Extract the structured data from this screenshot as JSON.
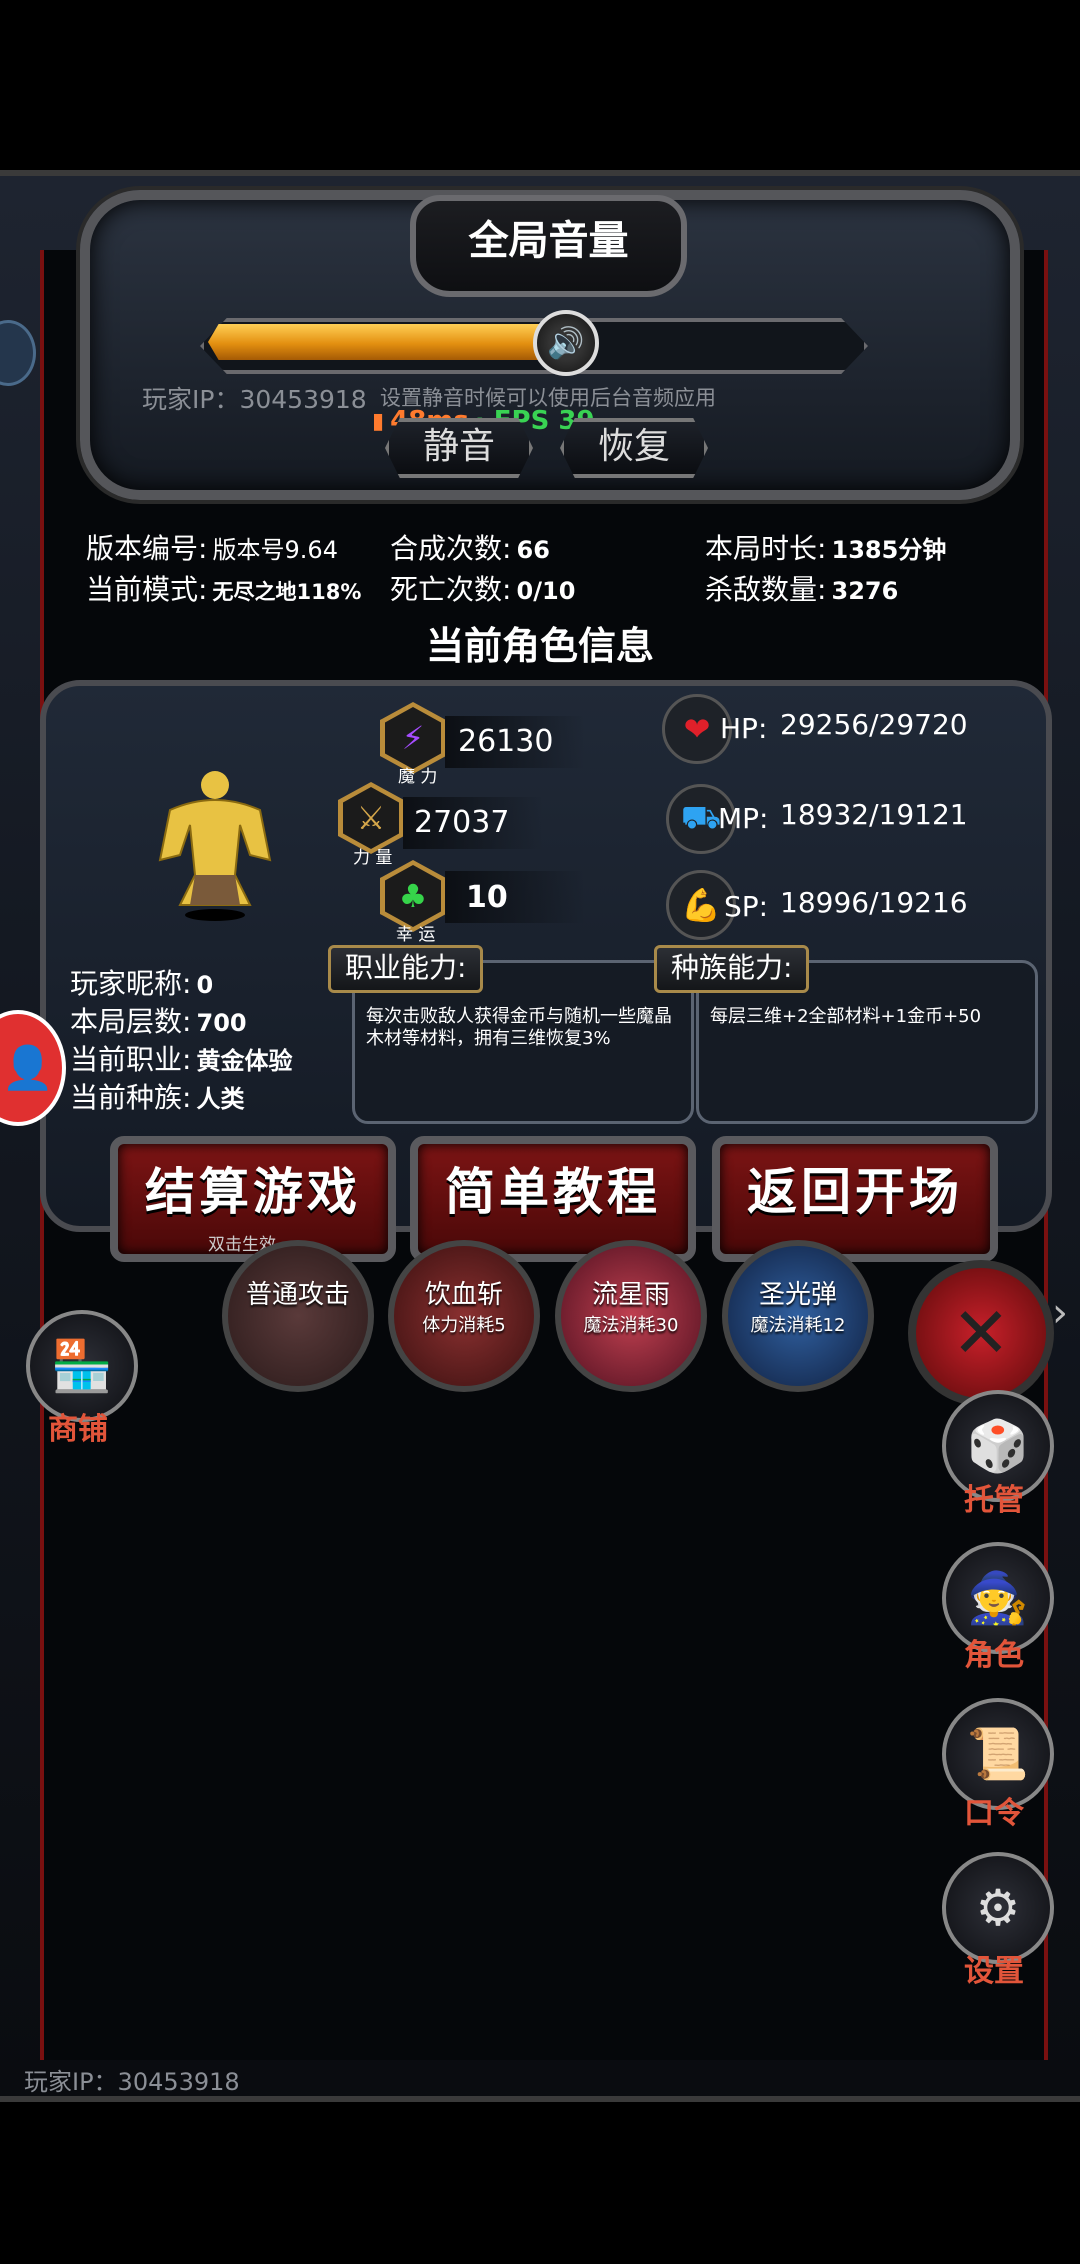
{
  "volume_panel": {
    "title": "全局音量",
    "level_percent": 55,
    "player_ip": "玩家IP：30453918",
    "mute_hint": "设置静音时候可以使用后台音频应用",
    "ping": "48ms",
    "fps": "· FPS 39",
    "mute_label": "静音",
    "restore_label": "恢复"
  },
  "info": {
    "version_label": "版本编号:",
    "version_value": "版本号9.64",
    "mode_label": "当前模式:",
    "mode_value": "无尽之地118%",
    "merge_label": "合成次数:",
    "merge_value": "66",
    "death_label": "死亡次数:",
    "death_value": "0/10",
    "duration_label": "本局时长:",
    "duration_value": "1385分钟",
    "kills_label": "杀敌数量:",
    "kills_value": "3276"
  },
  "character": {
    "section_title": "当前角色信息",
    "magic_value": "26130",
    "magic_label": "魔 力",
    "strength_value": "27037",
    "strength_label": "力 量",
    "luck_value": "10",
    "luck_label": "幸 运",
    "hp_label": "HP:",
    "hp_value": "29256/29720",
    "mp_label": "MP:",
    "mp_value": "18932/19121",
    "sp_label": "SP:",
    "sp_value": "18996/19216",
    "nickname_label": "玩家昵称:",
    "nickname_value": "0",
    "floor_label": "本局层数:",
    "floor_value": "700",
    "job_label": "当前职业:",
    "job_value": "黄金体验",
    "race_label": "当前种族:",
    "race_value": "人类",
    "job_ability_title": "职业能力:",
    "job_ability_text": "每次击败敌人获得金币与随机一些魔晶木材等材料，拥有三维恢复3%",
    "race_ability_title": "种族能力:",
    "race_ability_text": "每层三维+2全部材料+1金币+50"
  },
  "actions": {
    "settle_label": "结算游戏",
    "settle_sub": "双击生效",
    "tutorial_label": "简单教程",
    "return_label": "返回开场"
  },
  "skills": [
    {
      "name": "普通攻击",
      "cost": ""
    },
    {
      "name": "饮血斩",
      "cost": "体力消耗5"
    },
    {
      "name": "流星雨",
      "cost": "魔法消耗30"
    },
    {
      "name": "圣光弹",
      "cost": "魔法消耗12"
    }
  ],
  "side": {
    "shop_label": "商铺",
    "auto_label": "托管",
    "role_label": "角色",
    "code_label": "口令",
    "settings_label": "设置"
  },
  "footer_ip": "玩家IP：30453918",
  "colors": {
    "accent_orange": "#e2553a",
    "ping_orange": "#ff7b2e",
    "fps_green": "#39d353",
    "gold_fill": "#f0a020"
  }
}
